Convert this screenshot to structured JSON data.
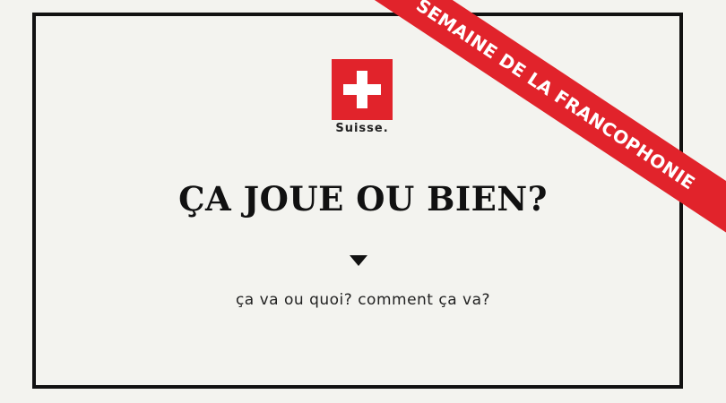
{
  "logo": {
    "text": "Suisse.",
    "flag_color": "#e1232b",
    "cross_color": "#ffffff",
    "icon": "swiss-flag-icon"
  },
  "headline": "ÇA JOUE OU BIEN?",
  "divider_icon": "triangle-down-icon",
  "subtitle": "ça va ou quoi? comment ça va?",
  "ribbon": {
    "text": "SEMAINE DE LA FRANCOPHONIE",
    "color": "#e1232b"
  },
  "colors": {
    "background": "#f3f3ef",
    "frame": "#111111",
    "text": "#111111"
  }
}
